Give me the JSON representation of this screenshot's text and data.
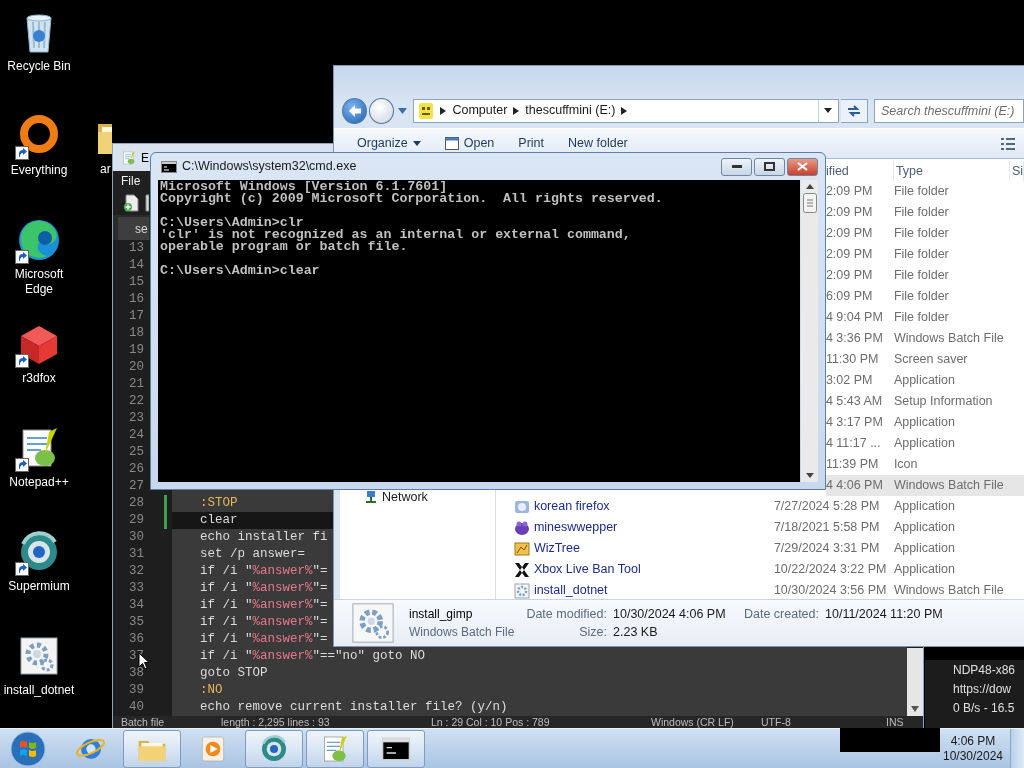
{
  "desktop_icons": [
    {
      "label": "Recycle Bin",
      "kind": "recycle-bin",
      "shortcut": false
    },
    {
      "label": "Everything",
      "kind": "ring",
      "shortcut": true
    },
    {
      "label": "Microsoft Edge",
      "kind": "swirl",
      "shortcut": true
    },
    {
      "label": "r3dfox",
      "kind": "cube",
      "shortcut": true
    },
    {
      "label": "Notepad++",
      "kind": "notepad",
      "shortcut": true
    },
    {
      "label": "Supermium",
      "kind": "globe",
      "shortcut": true
    },
    {
      "label": "install_dotnet",
      "kind": "gear",
      "shortcut": false
    },
    {
      "label": "ar",
      "kind": "folder",
      "shortcut": false
    }
  ],
  "download_window": {
    "lines": [
      "NDP48-x86",
      "https://dow",
      "0 B/s - 16.5"
    ]
  },
  "editor": {
    "title": "E",
    "menu": [
      "File"
    ],
    "tab": "se",
    "line_numbers": [
      "13",
      "14",
      "15",
      "16",
      "17",
      "18",
      "19",
      "20",
      "21",
      "22",
      "23",
      "24",
      "25",
      "26",
      "27"
    ],
    "lines": [
      {
        "number": "28",
        "selected": false,
        "modified": true,
        "code": [
          {
            "text": ":STOP",
            "kind": "label"
          }
        ]
      },
      {
        "number": "29",
        "selected": true,
        "modified": true,
        "code": [
          {
            "text": "clear",
            "kind": "plain"
          }
        ]
      },
      {
        "number": "30",
        "selected": false,
        "modified": false,
        "code": [
          {
            "text": "echo installer fi",
            "kind": "plain"
          }
        ]
      },
      {
        "number": "31",
        "selected": false,
        "modified": false,
        "code": [
          {
            "text": "set /p answer=",
            "kind": "plain"
          }
        ]
      },
      {
        "number": "32",
        "selected": false,
        "modified": false,
        "code": [
          {
            "text": "if /i \"",
            "kind": "plain"
          },
          {
            "text": "%answer%",
            "kind": "variable"
          },
          {
            "text": "\"=",
            "kind": "plain"
          }
        ]
      },
      {
        "number": "33",
        "selected": false,
        "modified": false,
        "code": [
          {
            "text": "if /i \"",
            "kind": "plain"
          },
          {
            "text": "%answer%",
            "kind": "variable"
          },
          {
            "text": "\"=",
            "kind": "plain"
          }
        ]
      },
      {
        "number": "34",
        "selected": false,
        "modified": false,
        "code": [
          {
            "text": "if /i \"",
            "kind": "plain"
          },
          {
            "text": "%answer%",
            "kind": "variable"
          },
          {
            "text": "\"=",
            "kind": "plain"
          }
        ]
      },
      {
        "number": "35",
        "selected": false,
        "modified": false,
        "code": [
          {
            "text": "if /i \"",
            "kind": "plain"
          },
          {
            "text": "%answer%",
            "kind": "variable"
          },
          {
            "text": "\"=",
            "kind": "plain"
          }
        ]
      },
      {
        "number": "36",
        "selected": false,
        "modified": false,
        "code": [
          {
            "text": "if /i \"",
            "kind": "plain"
          },
          {
            "text": "%answer%",
            "kind": "variable"
          },
          {
            "text": "\"=",
            "kind": "plain"
          }
        ]
      },
      {
        "number": "37",
        "selected": false,
        "modified": false,
        "code": [
          {
            "text": "if /i \"",
            "kind": "plain"
          },
          {
            "text": "%answer%",
            "kind": "variable"
          },
          {
            "text": "\"==\"no\" goto NO",
            "kind": "plain"
          }
        ]
      },
      {
        "number": "38",
        "selected": false,
        "modified": false,
        "code": [
          {
            "text": "goto STOP",
            "kind": "plain"
          }
        ]
      },
      {
        "number": "39",
        "selected": false,
        "modified": false,
        "code": [
          {
            "text": ":NO",
            "kind": "label"
          }
        ]
      },
      {
        "number": "40",
        "selected": false,
        "modified": false,
        "code": [
          {
            "text": "echo remove current installer file? (y/n)",
            "kind": "plain"
          }
        ]
      }
    ],
    "status": [
      "Batch file",
      "length : 2,295    lines : 93",
      "Ln : 29    Col : 10    Pos : 789",
      "Windows (CR LF)",
      "UTF-8",
      "INS"
    ]
  },
  "explorer": {
    "address": [
      "Computer",
      "thescuffmini (E:)"
    ],
    "search": {
      "placeholder": "Search thescuffmini (E:)"
    },
    "toolbar": [
      {
        "label": "Organize",
        "kind": "menu"
      },
      {
        "label": "Open",
        "kind": "open"
      },
      {
        "label": "Print",
        "kind": "plain"
      },
      {
        "label": "New folder",
        "kind": "plain"
      }
    ],
    "nav": [
      {
        "label": "Network"
      }
    ],
    "columns": [
      "ified",
      "Type",
      "Si"
    ],
    "rows": [
      {
        "date": "2:09 PM",
        "type": "File folder",
        "selected": false
      },
      {
        "date": "2:09 PM",
        "type": "File folder",
        "selected": false
      },
      {
        "date": "2:09 PM",
        "type": "File folder",
        "selected": false
      },
      {
        "date": "2:09 PM",
        "type": "File folder",
        "selected": false
      },
      {
        "date": "2:09 PM",
        "type": "File folder",
        "selected": false
      },
      {
        "date": "6:09 PM",
        "type": "File folder",
        "selected": false
      },
      {
        "date": "4 9:04 PM",
        "type": "File folder",
        "selected": false
      },
      {
        "date": "4 3:36 PM",
        "type": "Windows Batch File",
        "selected": false
      },
      {
        "date": "11:30 PM",
        "type": "Screen saver",
        "selected": false
      },
      {
        "date": "3:02 PM",
        "type": "Application",
        "selected": false
      },
      {
        "date": "4 5:43 AM",
        "type": "Setup Information",
        "selected": false
      },
      {
        "date": "4 3:17 PM",
        "type": "Application",
        "selected": false
      },
      {
        "date": "4 11:17 ...",
        "type": "Application",
        "selected": false
      },
      {
        "date": "11:39 PM",
        "type": "Icon",
        "selected": false
      },
      {
        "date": "4 4:06 PM",
        "type": "Windows Batch File",
        "selected": true
      },
      {
        "name": "korean firefox",
        "kind": "app",
        "date": "7/27/2024 5:28 PM",
        "type": "Application",
        "selected": false
      },
      {
        "name": "mineswwepper",
        "kind": "creature",
        "date": "7/18/2021 5:58 PM",
        "type": "Application",
        "selected": false
      },
      {
        "name": "WizTree",
        "kind": "chart",
        "date": "7/29/2024 3:31 PM",
        "type": "Application",
        "selected": false
      },
      {
        "name": "Xbox Live Ban Tool",
        "kind": "x",
        "date": "10/22/2024 3:22 PM",
        "type": "Application",
        "selected": false
      },
      {
        "name": "install_dotnet",
        "kind": "gear",
        "date": "10/30/2024 3:56 PM",
        "type": "Windows Batch File",
        "selected": false
      }
    ],
    "details": {
      "name": "install_gimp",
      "type": "Windows Batch File",
      "fields": [
        {
          "label": "Date modified:",
          "value": "10/30/2024 4:06 PM"
        },
        {
          "label": "Size:",
          "value": "2.23 KB"
        },
        {
          "label": "Date created:",
          "value": "10/11/2024 11:20 PM"
        }
      ]
    }
  },
  "console": {
    "title": "C:\\Windows\\system32\\cmd.exe",
    "blocks": [
      [
        "Microsoft Windows [Version 6.1.7601]",
        "Copyright (c) 2009 Microsoft Corporation.  All rights reserved."
      ],
      [
        "C:\\Users\\Admin>clr",
        "'clr' is not recognized as an internal or external command,",
        "operable program or batch file."
      ],
      [
        "C:\\Users\\Admin>clear"
      ]
    ]
  },
  "taskbar": {
    "items": [
      {
        "kind": "browser",
        "running": false
      },
      {
        "kind": "folder",
        "running": true
      },
      {
        "kind": "media",
        "running": false
      },
      {
        "kind": "globe",
        "running": true
      },
      {
        "kind": "notepad",
        "running": true
      },
      {
        "kind": "terminal",
        "running": true
      }
    ],
    "clock": {
      "time": "4:06 PM",
      "date": "10/30/2024"
    }
  }
}
